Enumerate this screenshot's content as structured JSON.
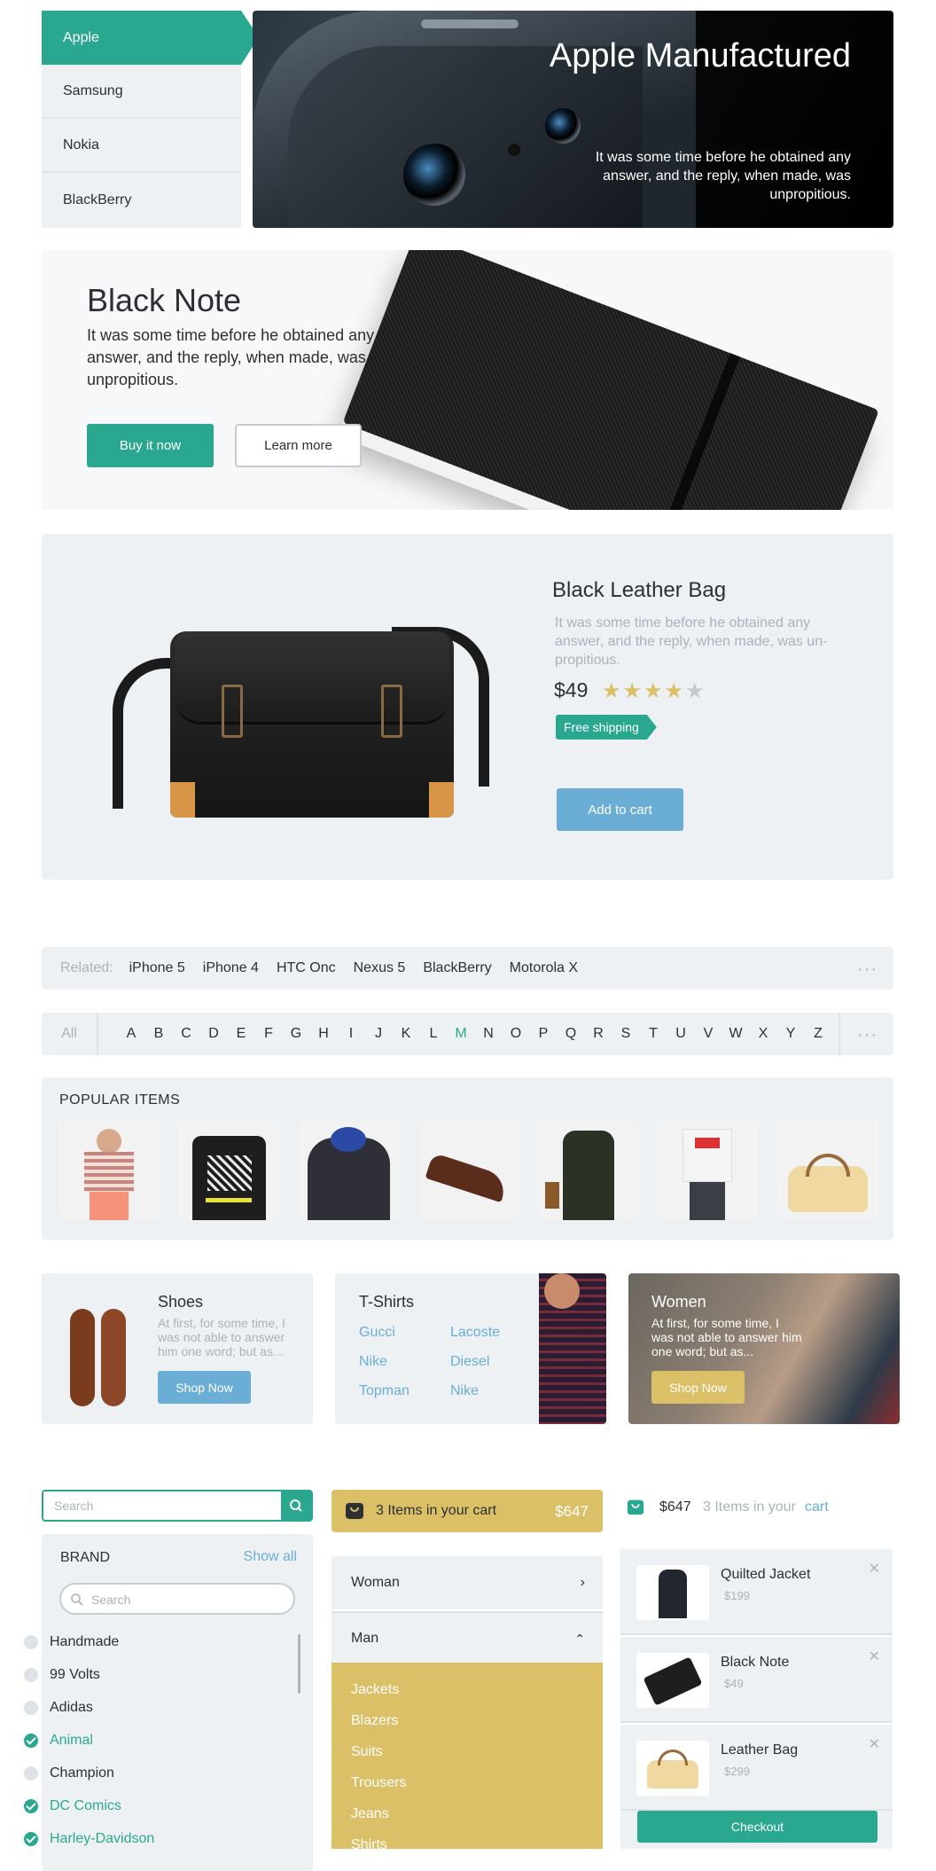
{
  "brand_tabs": [
    "Apple",
    "Samsung",
    "Nokia",
    "BlackBerry"
  ],
  "hero": {
    "title": "Apple Manufactured",
    "text": "It was some time before he obtained any answer, and the reply, when made, was unpropitious."
  },
  "note": {
    "title": "Black Note",
    "text": "It was some time before he obtained any answer, and the reply, when made, was unpropitious.",
    "buy": "Buy it now",
    "learn": "Learn more"
  },
  "bag": {
    "title": "Black Leather Bag",
    "desc": "It was some time before he obtained any answer, and the reply, when made, was un-propitious.",
    "price": "$49",
    "rating": 4,
    "tag": "Free shipping",
    "add": "Add to cart"
  },
  "related": {
    "label": "Related:",
    "items": [
      "iPhone 5",
      "iPhone 4",
      "HTC Onc",
      "Nexus 5",
      "BlackBerry",
      "Motorola X"
    ],
    "more": "···"
  },
  "alphabet": {
    "all": "All",
    "letters": [
      "A",
      "B",
      "C",
      "D",
      "E",
      "F",
      "G",
      "H",
      "I",
      "J",
      "K",
      "L",
      "M",
      "N",
      "O",
      "P",
      "Q",
      "R",
      "S",
      "T",
      "U",
      "V",
      "W",
      "X",
      "Y",
      "Z"
    ],
    "active": "M",
    "more": "···"
  },
  "popular": {
    "title": "POPULAR ITEMS"
  },
  "cards": {
    "shoes": {
      "title": "Shoes",
      "text": "At first, for some time, I was not able to answer him one word; but as...",
      "btn": "Shop Now"
    },
    "tshirts": {
      "title": "T-Shirts",
      "col1": [
        "Gucci",
        "Nike",
        "Topman"
      ],
      "col2": [
        "Lacoste",
        "Diesel",
        "Nike"
      ]
    },
    "women": {
      "title": "Women",
      "text": "At first, for some time, I was not able to answer him one word; but as...",
      "btn": "Shop Now"
    }
  },
  "search": {
    "placeholder": "Search"
  },
  "brand": {
    "title": "BRAND",
    "showall": "Show all",
    "search": "Search",
    "items": [
      {
        "label": "Handmade",
        "checked": false
      },
      {
        "label": "99 Volts",
        "checked": false
      },
      {
        "label": "Adidas",
        "checked": false
      },
      {
        "label": "Animal",
        "checked": true
      },
      {
        "label": "Champion",
        "checked": false
      },
      {
        "label": "DC Comics",
        "checked": true
      },
      {
        "label": "Harley-Davidson",
        "checked": true
      }
    ]
  },
  "cart": {
    "label": "3 Items in your cart",
    "total": "$647"
  },
  "accordion": {
    "woman": "Woman",
    "man": "Man",
    "sub": [
      "Jackets",
      "Blazers",
      "Suits",
      "Trousers",
      "Jeans",
      "Shirts"
    ]
  },
  "minicart": {
    "total": "$647",
    "count": "3 Items in your",
    "cart": "cart",
    "items": [
      {
        "name": "Quilted Jacket",
        "price": "$199"
      },
      {
        "name": "Black Note",
        "price": "$49"
      },
      {
        "name": "Leather Bag",
        "price": "$299"
      }
    ],
    "checkout": "Checkout"
  },
  "colors": {
    "teal": "#2aa88f",
    "blue": "#6aaed6",
    "gold": "#dbc068",
    "panel": "#eef1f4"
  }
}
